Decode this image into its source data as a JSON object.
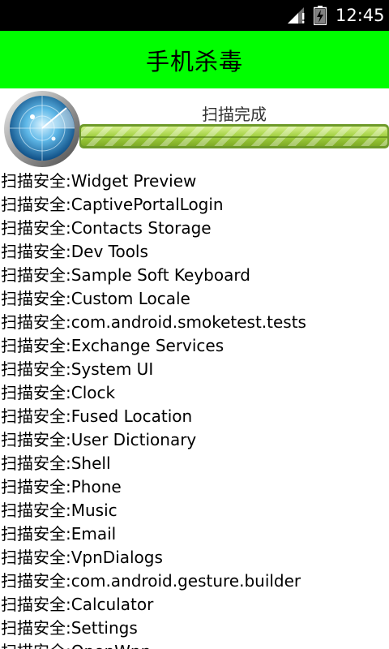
{
  "status_bar": {
    "time": "12:45",
    "icons": [
      "signal-icon",
      "battery-icon"
    ]
  },
  "title_bar": {
    "title": "手机杀毒",
    "color": "#00ff00"
  },
  "scan": {
    "status_text": "扫描完成",
    "progress": 1.0,
    "progress_color": "#9ccc3a",
    "icon": "radar-icon"
  },
  "results": [
    "扫描安全:Widget Preview",
    "扫描安全:CaptivePortalLogin",
    "扫描安全:Contacts Storage",
    "扫描安全:Dev Tools",
    "扫描安全:Sample Soft Keyboard",
    "扫描安全:Custom Locale",
    "扫描安全:com.android.smoketest.tests",
    "扫描安全:Exchange Services",
    "扫描安全:System UI",
    "扫描安全:Clock",
    "扫描安全:Fused Location",
    "扫描安全:User Dictionary",
    "扫描安全:Shell",
    "扫描安全:Phone",
    "扫描安全:Music",
    "扫描安全:Email",
    "扫描安全:VpnDialogs",
    "扫描安全:com.android.gesture.builder",
    "扫描安全:Calculator",
    "扫描安全:Settings",
    "扫描安全:OpenWnn"
  ]
}
